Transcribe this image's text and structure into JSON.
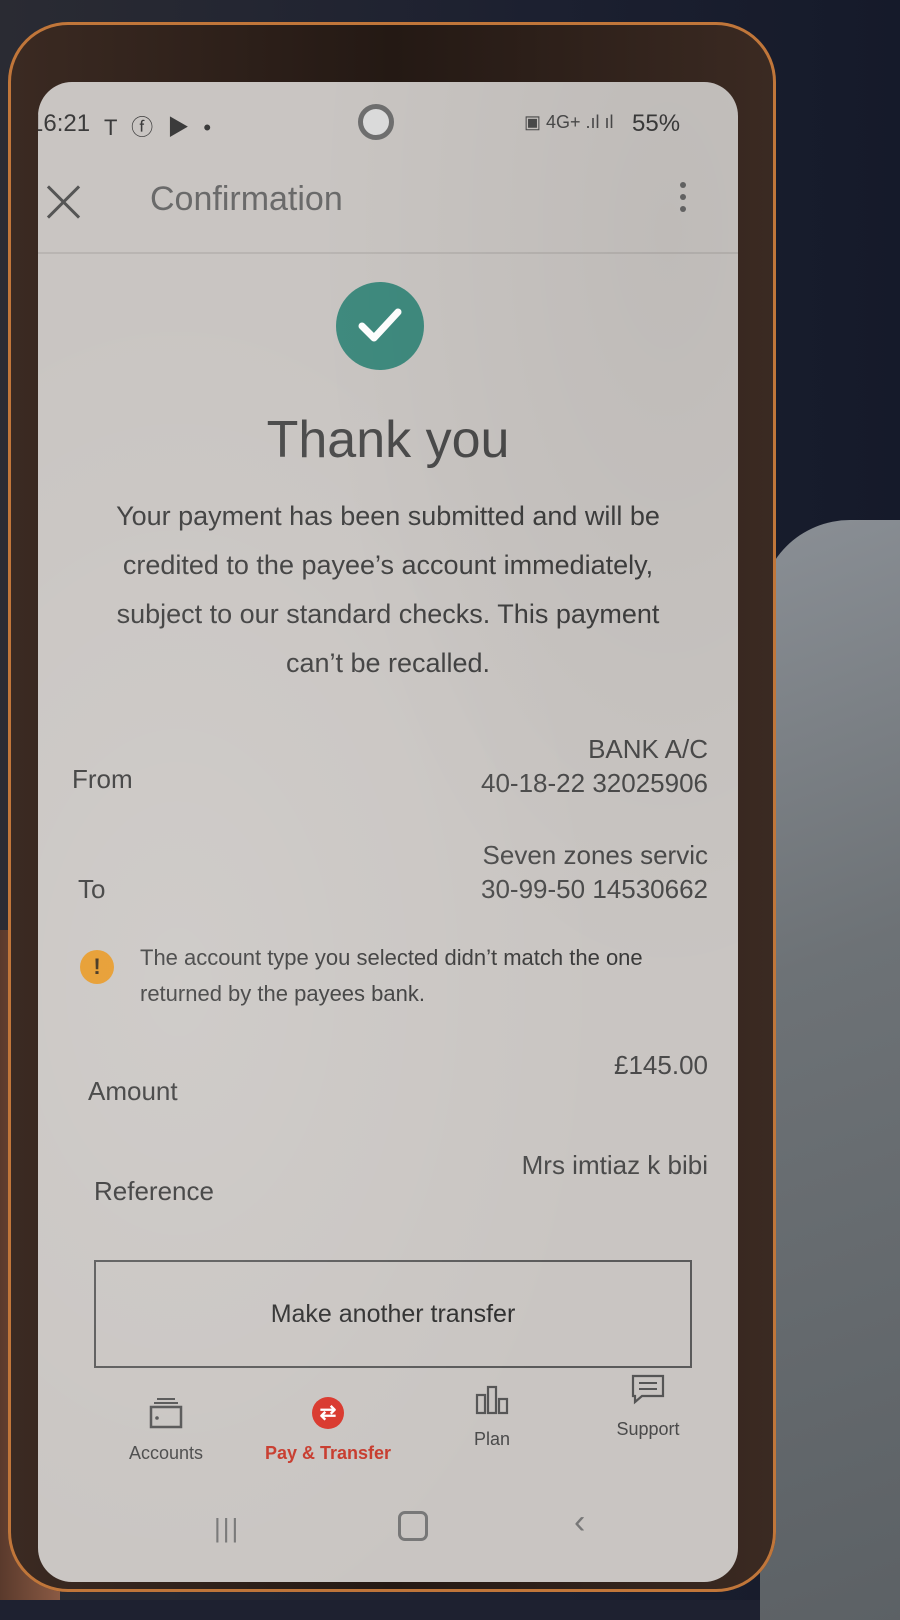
{
  "status_bar": {
    "time": "16:21",
    "left_icons": "T ⓕ ▶ •",
    "right_icons": "▣ 4G+ .ıl ıl",
    "battery": "55%"
  },
  "app_bar": {
    "title": "Confirmation"
  },
  "success": {
    "heading": "Thank you",
    "message": "Your payment has been submitted and will be credited to the payee’s account immediately, subject to our standard checks. This payment can’t be recalled."
  },
  "details": {
    "from_label": "From",
    "from_name": "BANK A/C",
    "from_account": "40-18-22 32025906",
    "to_label": "To",
    "to_name": "Seven zones servic",
    "to_account": "30-99-50 14530662",
    "warning": "The account type you selected didn’t match the one returned by the payees bank.",
    "warning_icon": "!",
    "amount_label": "Amount",
    "amount_value": "£145.00",
    "reference_label": "Reference",
    "reference_value": "Mrs imtiaz k bibi"
  },
  "actions": {
    "make_another_transfer": "Make another transfer"
  },
  "bottom_nav": {
    "items": [
      {
        "label": "Accounts",
        "icon": "wallet-icon"
      },
      {
        "label": "Pay & Transfer",
        "icon": "transfer-icon",
        "active": true
      },
      {
        "label": "Plan",
        "icon": "bar-chart-icon"
      },
      {
        "label": "Support",
        "icon": "chat-icon"
      }
    ]
  },
  "colors": {
    "accent_green": "#3f8a7e",
    "warning_orange": "#e69826",
    "active_red": "#c7392b"
  }
}
